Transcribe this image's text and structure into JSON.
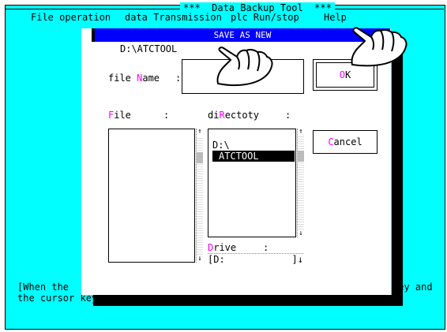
{
  "app": {
    "title": "***  Data Backup Tool  ***"
  },
  "menu": {
    "items": [
      "File operation",
      "data Transmission",
      "plc Run/stop",
      "Help"
    ]
  },
  "dialog": {
    "title": "SAVE AS NEW",
    "current_path": "D:\\ATCTOOL",
    "file_name": {
      "hot": "N",
      "label_pre": "file ",
      "label_post": "ame",
      "colon": ":",
      "value": ""
    },
    "ok_button": {
      "hot": "O",
      "rest": " K"
    },
    "cancel_button": {
      "hot": "C",
      "rest": "ancel"
    },
    "file_list": {
      "hot": "F",
      "label_rest": "ile",
      "colon": ":",
      "items": []
    },
    "directory_list": {
      "label_pre": "di",
      "hot": "R",
      "label_post": "ectoty",
      "colon": ":",
      "items": [
        "D:\\",
        "ATCTOOL"
      ],
      "selected_index": 1
    },
    "drive": {
      "hot": "D",
      "label_rest": "rive",
      "colon": ":",
      "value": "[D:",
      "suffix": "]↓"
    }
  },
  "hint": {
    "line1_left": "[When the",
    "line1_right": "key and",
    "line2": "the cursor key.]"
  },
  "colors": {
    "screen": "#00ffff",
    "header": "#0000ff",
    "hotkey": "#ff00ff",
    "selection": "#000000"
  },
  "icons": [
    "pointing-hand-icon"
  ]
}
